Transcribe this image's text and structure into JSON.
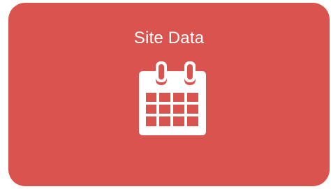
{
  "tile": {
    "title": "Site Data",
    "icon": "calendar-icon",
    "background_color": "#d9534f",
    "text_color": "#ffffff"
  }
}
